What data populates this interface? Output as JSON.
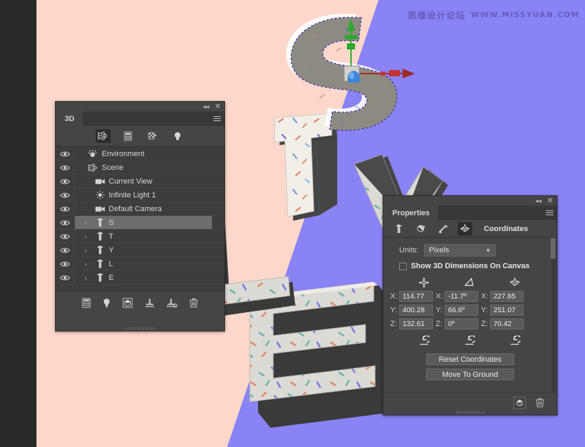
{
  "watermark": {
    "cn": "思缘设计论坛",
    "url": "WWW.MISSYUAN.COM"
  },
  "canvas": {
    "background_pink": "#fdd7c9",
    "background_purple": "#8a83f5",
    "letters": [
      {
        "char": "S",
        "selected": true
      },
      {
        "char": "T",
        "selected": false
      },
      {
        "char": "Y",
        "selected": false
      },
      {
        "char": "L",
        "selected": false
      },
      {
        "char": "E",
        "selected": false
      }
    ],
    "gizmo": {
      "x_axis_color": "#b03030",
      "y_axis_color": "#2fa82f",
      "z_axis_color": "#2f7ad0"
    }
  },
  "panel_3d": {
    "tab_label": "3D",
    "toolbar": [
      {
        "name": "scene-icon",
        "active": true
      },
      {
        "name": "mesh-icon",
        "active": false
      },
      {
        "name": "materials-icon",
        "active": false
      },
      {
        "name": "lights-icon",
        "active": false
      }
    ],
    "tree": [
      {
        "label": "Environment",
        "icon": "environment-icon",
        "indent": 0,
        "twisty": false,
        "selected": false
      },
      {
        "label": "Scene",
        "icon": "scene-icon",
        "indent": 0,
        "twisty": false,
        "selected": false
      },
      {
        "label": "Current View",
        "icon": "camera-icon",
        "indent": 1,
        "twisty": false,
        "selected": false
      },
      {
        "label": "Infinite Light 1",
        "icon": "light-icon",
        "indent": 1,
        "twisty": false,
        "selected": false
      },
      {
        "label": "Default Camera",
        "icon": "camera-icon",
        "indent": 1,
        "twisty": false,
        "selected": false
      },
      {
        "label": "S",
        "icon": "mesh-icon",
        "indent": 1,
        "twisty": true,
        "selected": true
      },
      {
        "label": "T",
        "icon": "mesh-icon",
        "indent": 1,
        "twisty": true,
        "selected": false
      },
      {
        "label": "Y",
        "icon": "mesh-icon",
        "indent": 1,
        "twisty": true,
        "selected": false
      },
      {
        "label": "L",
        "icon": "mesh-icon",
        "indent": 1,
        "twisty": true,
        "selected": false
      },
      {
        "label": "E",
        "icon": "mesh-icon",
        "indent": 1,
        "twisty": true,
        "selected": false
      }
    ],
    "footer_icons": [
      "add-mesh-icon",
      "add-light-icon",
      "render-icon",
      "add-ground-plane-icon",
      "remove-ground-plane-icon",
      "delete-icon"
    ]
  },
  "panel_properties": {
    "tab_label": "Properties",
    "toolbar": [
      {
        "name": "mesh-icon",
        "active": false
      },
      {
        "name": "materials-icon",
        "active": false
      },
      {
        "name": "light-icon",
        "active": false
      },
      {
        "name": "coordinates-icon",
        "active": true
      }
    ],
    "title": "Coordinates",
    "units_label": "Units:",
    "units_value": "Pixels",
    "show_dimensions_label": "Show 3D Dimensions On Canvas",
    "show_dimensions_checked": false,
    "column_icons": [
      "position-icon",
      "rotation-icon",
      "scale-icon"
    ],
    "position": {
      "label_x": "X:",
      "label_y": "Y:",
      "label_z": "Z:",
      "x": "114.77",
      "y": "400.28",
      "z": "132.61"
    },
    "rotation": {
      "label_x": "X:",
      "label_y": "Y:",
      "label_z": "Z:",
      "x": "-11.7º",
      "y": "66.6º",
      "z": "0º"
    },
    "scale": {
      "label_x": "X:",
      "label_y": "Y:",
      "label_z": "Z:",
      "x": "227.85",
      "y": "251.07",
      "z": "70.42"
    },
    "reset_coordinates_label": "Reset Coordinates",
    "move_to_ground_label": "Move To Ground",
    "footer_icons": [
      "render-icon",
      "delete-icon"
    ]
  }
}
